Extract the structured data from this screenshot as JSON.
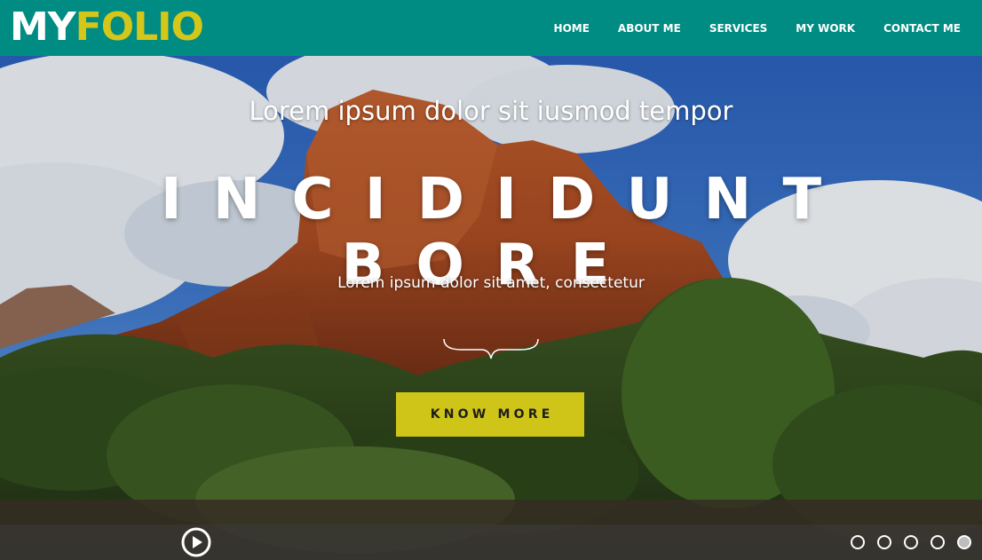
{
  "brand": {
    "part1": "MY",
    "part2": "FOLIO",
    "color_part1": "#ffffff",
    "color_part2": "#d4c719"
  },
  "nav": {
    "items": [
      {
        "label": "HOME"
      },
      {
        "label": "ABOUT ME"
      },
      {
        "label": "SERVICES"
      },
      {
        "label": "MY WORK"
      },
      {
        "label": "CONTACT ME"
      }
    ]
  },
  "hero": {
    "eyebrow": "Lorem ipsum dolor sit iusmod tempor",
    "headline": "INCIDIDUNT BORE",
    "subline": "Lorem ipsum dolor sit amet, consectetur",
    "cta_label": "KNOW MORE",
    "background": "red rock butte with blue cloudy sky and green trees"
  },
  "slider": {
    "play_icon": "play-circle-icon",
    "slides_count": 5,
    "active_index": 4
  },
  "colors": {
    "header_bg": "#008c82",
    "accent": "#cfc519",
    "text_light": "#ffffff"
  }
}
